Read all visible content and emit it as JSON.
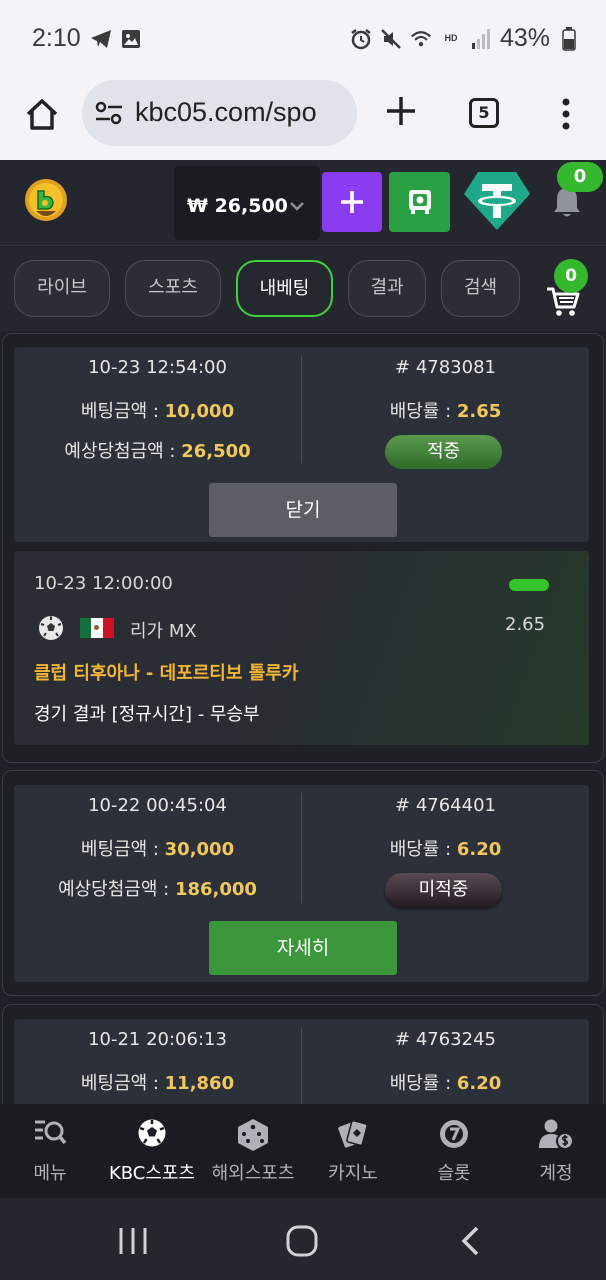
{
  "status_bar": {
    "time": "2:10",
    "battery": "43%",
    "hd_label": "HD"
  },
  "browser": {
    "url": "kbc05.com/spo",
    "tab_count": "5"
  },
  "header": {
    "balance": "₩ 26,500",
    "notification_count": "0"
  },
  "tabs": [
    {
      "label": "라이브",
      "active": false
    },
    {
      "label": "스포츠",
      "active": false
    },
    {
      "label": "내베팅",
      "active": true
    },
    {
      "label": "결과",
      "active": false
    },
    {
      "label": "검색",
      "active": false
    }
  ],
  "cart_count": "0",
  "bets": [
    {
      "datetime": "10-23 12:54:00",
      "id": "# 4783081",
      "amount_label": "베팅금액 : ",
      "amount": "10,000",
      "odds_label": "배당률 : ",
      "odds": "2.65",
      "expected_label": "예상당첨금액 : ",
      "expected": "26,500",
      "status": "적중",
      "button": "닫기"
    },
    {
      "datetime": "10-22 00:45:04",
      "id": "# 4764401",
      "amount_label": "베팅금액 : ",
      "amount": "30,000",
      "odds_label": "배당률 : ",
      "odds": "6.20",
      "expected_label": "예상당첨금액 : ",
      "expected": "186,000",
      "status": "미적중",
      "button": "자세히"
    },
    {
      "datetime": "10-21 20:06:13",
      "id": "# 4763245",
      "amount_label": "베팅금액 : ",
      "amount": "11,860",
      "odds_label": "배당률 : ",
      "odds": "6.20"
    }
  ],
  "bet_detail": {
    "datetime": "10-23 12:00:00",
    "league": "리가 MX",
    "odds": "2.65",
    "match": "클럽 티후아나 - 데포르티보 톨루카",
    "result": "경기 결과 [정규시간] - 무승부"
  },
  "bottom_nav": [
    {
      "label": "메뉴",
      "icon": "menu-search-icon"
    },
    {
      "label": "KBC스포츠",
      "icon": "soccer-ball-icon",
      "active": true
    },
    {
      "label": "해외스포츠",
      "icon": "dice-icon"
    },
    {
      "label": "카지노",
      "icon": "cards-icon"
    },
    {
      "label": "슬롯",
      "icon": "slot-seven-icon"
    },
    {
      "label": "계정",
      "icon": "account-coins-icon"
    }
  ],
  "colors": {
    "accent_green": "#35b72e",
    "highlight_value": "#f2c75c",
    "match_title": "#f2b535",
    "deposit_purple": "#8a3cf0"
  }
}
